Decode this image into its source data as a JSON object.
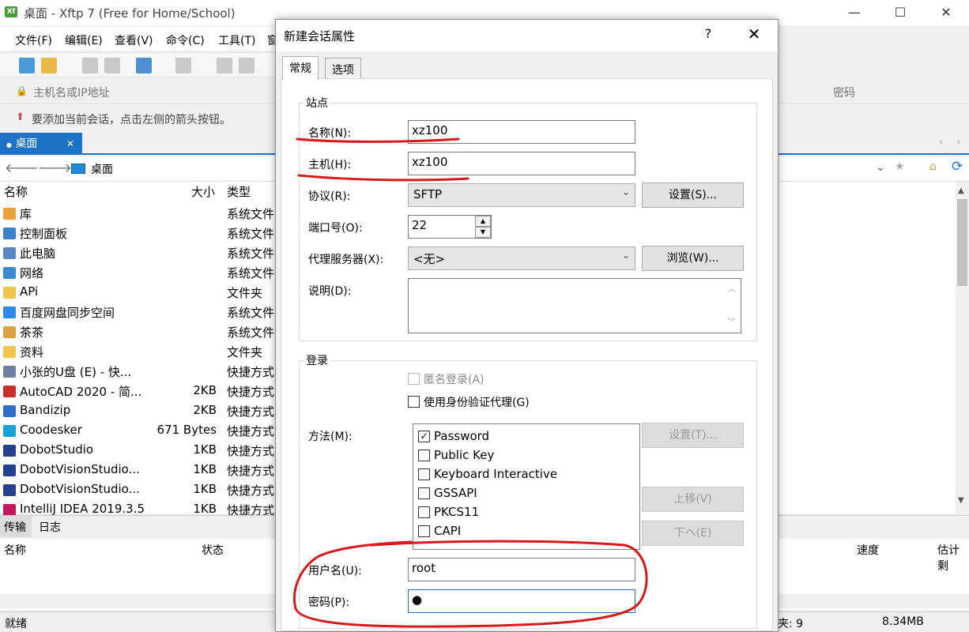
{
  "main_window": {
    "title": "桌面 - Xftp 7 (Free for Home/School)",
    "app_icon": "xftp-app-icon",
    "menu": [
      "文件(F)",
      "编辑(E)",
      "查看(V)",
      "命令(C)",
      "工具(T)",
      "窗"
    ],
    "address_placeholder": "主机名或IP地址",
    "password_placeholder": "密码",
    "hint": "要添加当前会话，点击左侧的箭头按钮。",
    "tab": "桌面",
    "path": "桌面",
    "columns": {
      "name": "名称",
      "size": "大小",
      "type": "类型"
    },
    "files": [
      {
        "name": "库",
        "size": "",
        "type": "系统文件",
        "icon": "library-icon",
        "color": "#e8a33b"
      },
      {
        "name": "控制面板",
        "size": "",
        "type": "系统文件",
        "icon": "control-panel-icon",
        "color": "#3d7fc7"
      },
      {
        "name": "此电脑",
        "size": "",
        "type": "系统文件",
        "icon": "computer-icon",
        "color": "#5a87c2"
      },
      {
        "name": "网络",
        "size": "",
        "type": "系统文件",
        "icon": "network-icon",
        "color": "#3b8bd1"
      },
      {
        "name": "APi",
        "size": "",
        "type": "文件夹",
        "icon": "folder-icon",
        "color": "#f1c44b"
      },
      {
        "name": "百度网盘同步空间",
        "size": "",
        "type": "系统文件",
        "icon": "baidu-cloud-icon",
        "color": "#2e8ae6"
      },
      {
        "name": "茶茶",
        "size": "",
        "type": "系统文件",
        "icon": "user-folder-icon",
        "color": "#d9a441"
      },
      {
        "name": "资料",
        "size": "",
        "type": "文件夹",
        "icon": "folder-icon",
        "color": "#f1c44b"
      },
      {
        "name": "小张的U盘 (E) - 快...",
        "size": "",
        "type": "快捷方式",
        "icon": "usb-shortcut-icon",
        "color": "#6d7fa3"
      },
      {
        "name": "AutoCAD 2020 - 简...",
        "size": "2KB",
        "type": "快捷方式",
        "icon": "autocad-icon",
        "color": "#c8302d"
      },
      {
        "name": "Bandizip",
        "size": "2KB",
        "type": "快捷方式",
        "icon": "bandizip-icon",
        "color": "#2f6fcc"
      },
      {
        "name": "Coodesker",
        "size": "671 Bytes",
        "type": "快捷方式",
        "icon": "coodesker-icon",
        "color": "#18a0d8"
      },
      {
        "name": "DobotStudio",
        "size": "1KB",
        "type": "快捷方式",
        "icon": "dobot-icon",
        "color": "#24418f"
      },
      {
        "name": "DobotVisionStudio...",
        "size": "1KB",
        "type": "快捷方式",
        "icon": "dobot-icon",
        "color": "#24418f"
      },
      {
        "name": "DobotVisionStudio...",
        "size": "1KB",
        "type": "快捷方式",
        "icon": "dobot-icon",
        "color": "#24418f"
      },
      {
        "name": "IntelliJ IDEA 2019.3.5",
        "size": "1KB",
        "type": "快捷方式",
        "icon": "intellij-icon",
        "color": "#c2185b"
      }
    ],
    "bottom_tabs": [
      "传输",
      "日志"
    ],
    "transfer_columns": {
      "name": "名称",
      "status": "状态",
      "speed": "速度",
      "eta": "估计剩"
    },
    "status": {
      "ready": "就绪",
      "count": "夹: 9",
      "size": "8.34MB"
    }
  },
  "dialog": {
    "title": "新建会话属性",
    "help": "?",
    "close": "✕",
    "tabs": [
      "常规",
      "选项"
    ],
    "site_group": "站点",
    "name_label": "名称(N):",
    "name_value": "xz100",
    "host_label": "主机(H):",
    "host_value": "xz100",
    "protocol_label": "协议(R):",
    "protocol_value": "SFTP",
    "settings_button": "设置(S)...",
    "port_label": "端口号(O):",
    "port_value": "22",
    "proxy_label": "代理服务器(X):",
    "proxy_value": "<无>",
    "browse_button": "浏览(W)...",
    "desc_label": "说明(D):",
    "login_group": "登录",
    "anonymous_label": "匿名登录(A)",
    "agent_label": "使用身份验证代理(G)",
    "method_label": "方法(M):",
    "method_settings_button": "设置(T)...",
    "methods": [
      {
        "label": "Password",
        "checked": true
      },
      {
        "label": "Public Key",
        "checked": false
      },
      {
        "label": "Keyboard Interactive",
        "checked": false
      },
      {
        "label": "GSSAPI",
        "checked": false
      },
      {
        "label": "PKCS11",
        "checked": false
      },
      {
        "label": "CAPI",
        "checked": false
      }
    ],
    "move_up_button": "上移(V)",
    "move_down_button": "下へ(E)",
    "user_label": "用户名(U):",
    "user_value": "root",
    "password_label": "密码(P):",
    "password_value": "●",
    "annotation_color": "#d7191c"
  }
}
